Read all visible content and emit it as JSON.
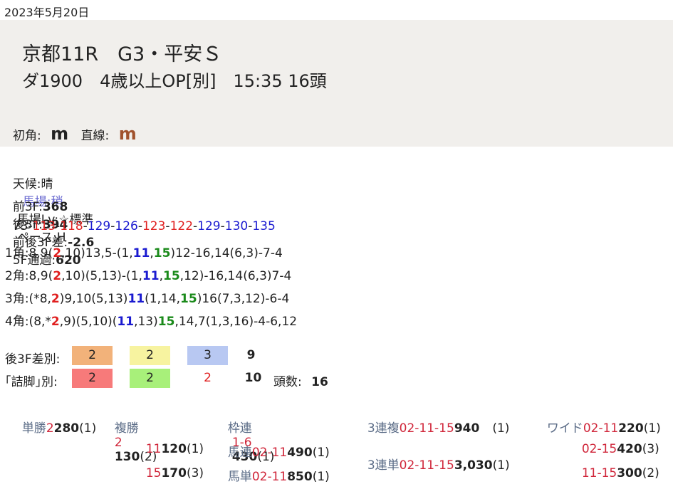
{
  "date": "2023年5月20日",
  "race": {
    "title": "京都11R　G3・平安Ｓ",
    "subtitle": "ダ1900　4歳以上OP[別]　15:35 16頭",
    "corner_label": "初角:",
    "corner_value": "m",
    "straight_label": "直線:",
    "straight_value": "m"
  },
  "conditions": {
    "weather": "天候:晴",
    "track": "馬場:稍",
    "level": "馬場Lv:☆標準",
    "pace": "ペース:H"
  },
  "times": {
    "f3_label": "前3F:",
    "f3": "368",
    "l3_label": "後3F:",
    "l3": "394",
    "diff_label": "前後3F差:",
    "diff": "-2.6",
    "f5_label": "5F通過:",
    "f5": "620"
  },
  "laps": [
    "73",
    "113",
    "118",
    "129",
    "126",
    "123",
    "122",
    "129",
    "130",
    "135"
  ],
  "corners": [
    {
      "label": "1角:",
      "text": "1角:8,9(2,10)13,5-(1,11,15)12-16,14(6,3)-7-4"
    },
    {
      "label": "2角:",
      "text": "2角:8,9(2,10)(5,13)-(1,11,15,12)-16,14(6,3)7-4"
    },
    {
      "label": "3角:",
      "text": "3角:(*8,2)9,10(5,13)11(1,14,15)16(7,3,12)-6-4"
    },
    {
      "label": "4角:",
      "text": "4角:(8,*2,9)(5,10)(11,13)15,14,7(1,3,16)-4-6,12"
    }
  ],
  "diff_table": {
    "row1_label": "後3F差別:",
    "row1": [
      "2",
      "2",
      "3",
      "9"
    ],
    "row2_label": "｢詰脚｣別:",
    "row2": [
      "2",
      "2",
      "2",
      "10"
    ],
    "heads_label": "頭数:",
    "heads": "16",
    "colors": {
      "orange": "#f2b27a",
      "yellow": "#f7f3a0",
      "blue": "#b8c8f2",
      "red": "#f77a7a",
      "green": "#a8f07a"
    }
  },
  "payouts": {
    "tansho": {
      "label": "単勝",
      "num": "2",
      "amount": "280",
      "pop": "(1)"
    },
    "fukusho": {
      "label": "複勝",
      "rows": [
        {
          "num": "2",
          "amount": "130",
          "pop": "(2)"
        },
        {
          "num": "11",
          "amount": "120",
          "pop": "(1)"
        },
        {
          "num": "15",
          "amount": "170",
          "pop": "(3)"
        }
      ]
    },
    "wakuren": {
      "label": "枠連",
      "num": "1-6",
      "amount": "430",
      "pop": "(1)"
    },
    "umaren": {
      "label": "馬連",
      "num": "02-11",
      "amount": "490",
      "pop": "(1)"
    },
    "umatan": {
      "label": "馬単",
      "num": "02-11",
      "amount": "850",
      "pop": "(1)"
    },
    "sanrenpuku": {
      "label": "3連複",
      "num": "02-11-15",
      "amount": "940",
      "pop": "(1)"
    },
    "sanrentan": {
      "label": "3連単",
      "num": "02-11-15",
      "amount": "3,030",
      "pop": "(1)"
    },
    "wide": {
      "label": "ワイド",
      "rows": [
        {
          "num": "02-11",
          "amount": "220",
          "pop": "(1)"
        },
        {
          "num": "02-15",
          "amount": "420",
          "pop": "(3)"
        },
        {
          "num": "11-15",
          "amount": "300",
          "pop": "(2)"
        }
      ]
    }
  }
}
